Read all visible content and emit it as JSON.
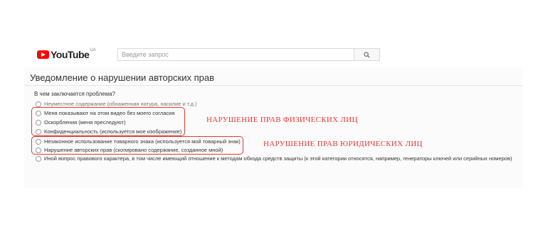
{
  "header": {
    "logo_text": "YouTube",
    "logo_region": "UA",
    "search_placeholder": "Введите запрос"
  },
  "page_title": "Уведомление о нарушении авторских прав",
  "question": "В чем заключается проблема?",
  "options": [
    {
      "label": "Неуместное содержание (обнаженная натура, насилие и т.д.)"
    },
    {
      "label": "Меня показывают на этом видео без моего согласия"
    },
    {
      "label": "Оскорбления (меня преследуют)"
    },
    {
      "label": "Конфиденциальность (используется мое изображение)"
    },
    {
      "label": "Незаконное использование товарного знака (используется мой товарный знак)"
    },
    {
      "label": "Нарушение авторских прав (скопировано содержание, созданное мной)"
    },
    {
      "label": "Иной вопрос правового характера, в том числе имеющий отношение к методам обхода средств защиты (к этой категории относятся, например, генераторы ключей или серийных номеров)"
    }
  ],
  "annotations": {
    "individuals": "НАРУШЕНИЕ ПРАВ ФИЗИЧЕСКИХ ЛИЦ",
    "legal_entities": "НАРУШЕНИЕ ПРАВ ЮРИДИЧЕСКИХ ЛИЦ"
  },
  "colors": {
    "annotation": "#e53935",
    "brand": "#ff0000"
  },
  "icons": {
    "search": "search-icon",
    "logo": "youtube-logo-icon"
  }
}
